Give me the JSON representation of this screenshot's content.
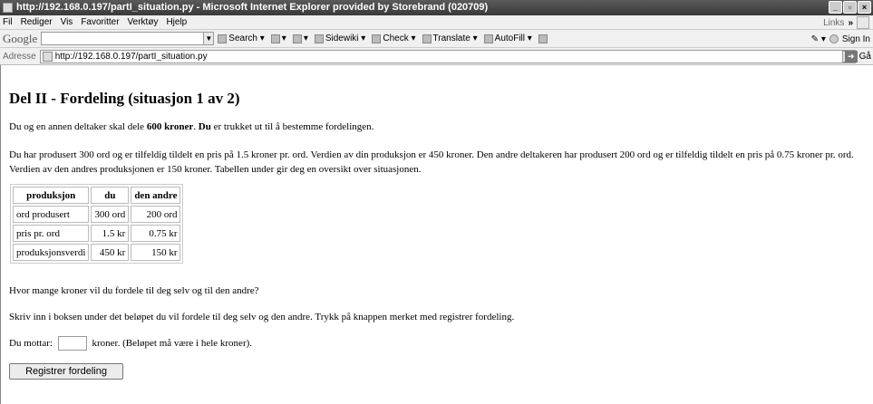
{
  "window": {
    "title": "http://192.168.0.197/partI_situation.py - Microsoft Internet Explorer provided by Storebrand (020709)"
  },
  "menu": {
    "items": [
      "Fil",
      "Rediger",
      "Vis",
      "Favoritter",
      "Verktøy",
      "Hjelp"
    ],
    "links_label": "Links",
    "links_more": "»"
  },
  "google_toolbar": {
    "logo": "Google",
    "search_label": "Search",
    "sidewiki_label": "Sidewiki",
    "check_label": "Check",
    "translate_label": "Translate",
    "autofill_label": "AutoFill",
    "signin_label": "Sign In"
  },
  "address": {
    "label": "Adresse",
    "url": "http://192.168.0.197/partI_situation.py",
    "go_label": "Gå"
  },
  "page": {
    "heading": "Del II - Fordeling (situasjon 1 av 2)",
    "intro_prefix": "Du og en annen deltaker skal dele ",
    "intro_amount": "600 kroner",
    "intro_mid": ". ",
    "intro_du": "Du",
    "intro_suffix": " er trukket ut til å bestemme fordelingen.",
    "description": "Du har produsert 300 ord og er tilfeldig tildelt en pris på 1.5 kroner pr. ord. Verdien av din produksjon er 450 kroner. Den andre deltakeren har produsert 200 ord og er tilfeldig tildelt en pris på 0.75 kroner pr. ord. Verdien av den andres produksjonen er 150 kroner. Tabellen under gir deg en oversikt over situasjonen.",
    "question": "Hvor mange kroner vil du fordele til deg selv og til den andre?",
    "instruction": "Skriv inn i boksen under det beløpet du vil fordele til deg selv og den andre. Trykk på knappen merket med registrer fordeling.",
    "receive_label": "Du mottar:",
    "receive_suffix": "kroner. (Beløpet må være i hele kroner).",
    "receive_value": "",
    "submit_label": "Registrer fordeling"
  },
  "table": {
    "headers": [
      "produksjon",
      "du",
      "den andre"
    ],
    "rows": [
      [
        "ord produsert",
        "300 ord",
        "200 ord"
      ],
      [
        "pris pr. ord",
        "1.5 kr",
        "0.75 kr"
      ],
      [
        "produksjonsverdi",
        "450 kr",
        "150 kr"
      ]
    ]
  }
}
